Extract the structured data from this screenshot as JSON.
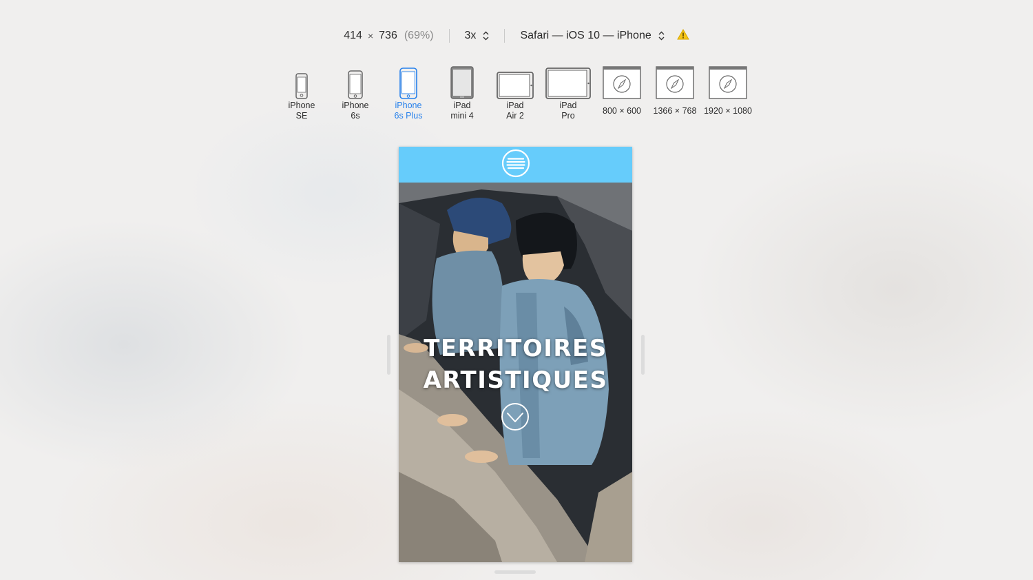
{
  "toolbar": {
    "width": "414",
    "times": "×",
    "height": "736",
    "zoom": "(69%)",
    "scale": "3x",
    "user_agent": "Safari — iOS 10 — iPhone",
    "warning_icon": "warning-icon"
  },
  "devices": [
    {
      "label": "iPhone\nSE",
      "icon": "phone-small-icon"
    },
    {
      "label": "iPhone\n6s",
      "icon": "phone-icon"
    },
    {
      "label": "iPhone\n6s Plus",
      "icon": "phone-large-icon",
      "active": true
    },
    {
      "label": "iPad\nmini 4",
      "icon": "tablet-portrait-icon"
    },
    {
      "label": "iPad\nAir 2",
      "icon": "tablet-landscape-icon"
    },
    {
      "label": "iPad\nPro",
      "icon": "tablet-pro-icon"
    },
    {
      "label": "800 × 600",
      "icon": "safari-window-icon"
    },
    {
      "label": "1366 × 768",
      "icon": "safari-window-icon"
    },
    {
      "label": "1920 × 1080",
      "icon": "safari-window-icon"
    }
  ],
  "page": {
    "header_color": "#66ccfb",
    "menu_icon": "hamburger-menu-icon",
    "hero_title_line1": "TERRITOIRES",
    "hero_title_line2": "ARTISTIQUES",
    "scroll_icon": "chevron-down-circle-icon"
  },
  "colors": {
    "accent": "#2680eb",
    "header": "#66ccfb",
    "background": "#f0efee"
  }
}
